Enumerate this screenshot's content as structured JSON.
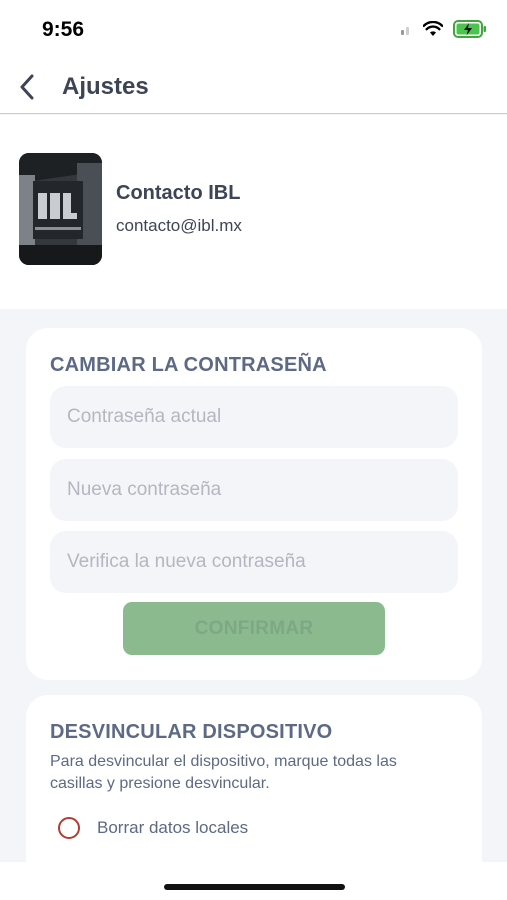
{
  "status_bar": {
    "time": "9:56"
  },
  "header": {
    "title": "Ajustes"
  },
  "profile": {
    "name": "Contacto IBL",
    "email": "contacto@ibl.mx"
  },
  "password_card": {
    "title": "CAMBIAR LA CONTRASEÑA",
    "current_placeholder": "Contraseña actual",
    "new_placeholder": "Nueva contraseña",
    "verify_placeholder": "Verifica la nueva contraseña",
    "confirm_label": "CONFIRMAR"
  },
  "unlink_card": {
    "title": "DESVINCULAR DISPOSITIVO",
    "description": "Para desvincular el dispositivo, marque todas las casillas y presione desvincular.",
    "options": [
      {
        "label": "Borrar datos locales"
      }
    ]
  },
  "colors": {
    "accent_green": "#8cba8f",
    "radio_red": "#b43c35",
    "section_title": "#5d6985"
  }
}
